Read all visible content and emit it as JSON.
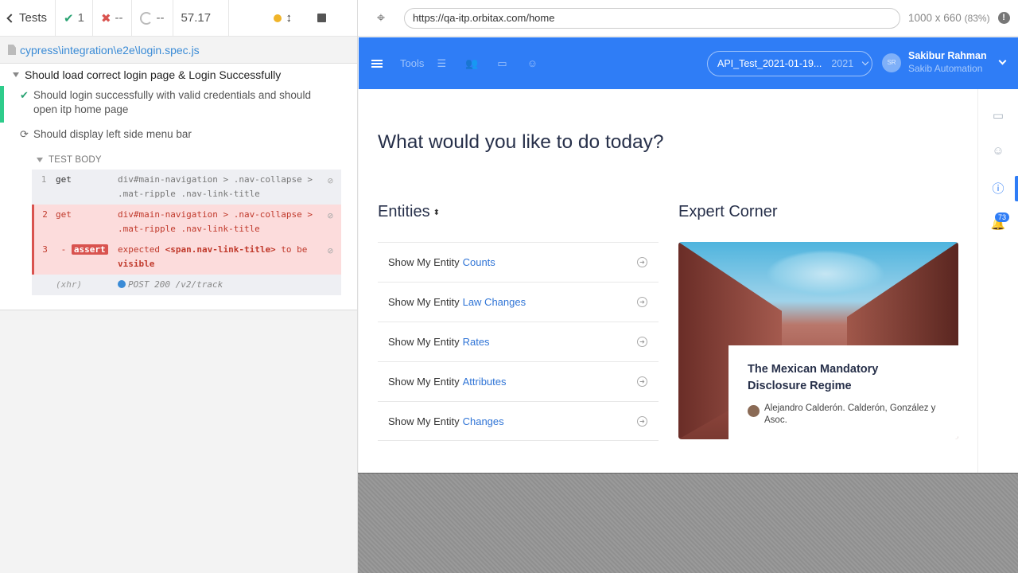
{
  "reporter": {
    "back_label": "Tests",
    "passed_count": "1",
    "failed_count": "--",
    "pending_count": "--",
    "duration": "57.17",
    "spec_path": "cypress\\integration\\e2e\\login.spec.js",
    "suite_title": "Should load correct login page & Login Successfully",
    "tests": [
      {
        "title": "Should login successfully with valid credentials and should open itp home page",
        "state": "passed"
      },
      {
        "title": "Should display left side menu bar",
        "state": "running"
      }
    ],
    "test_body_label": "TEST BODY",
    "commands": [
      {
        "num": "1",
        "name": "get",
        "message": "div#main-navigation > .nav-collapse > .mat-ripple .nav-link-title"
      },
      {
        "num": "2",
        "name": "get",
        "message": "div#main-navigation > .nav-collapse > .mat-ripple .nav-link-title"
      },
      {
        "num": "3",
        "name": "-assert",
        "badge": "assert",
        "message_pre": "expected",
        "message_el": "<span.nav-link-title>",
        "message_mid": "to be",
        "message_post": "visible"
      },
      {
        "num": "",
        "name": "(xhr)",
        "message": "POST 200 /v2/track"
      }
    ]
  },
  "browser": {
    "url": "https://qa-itp.orbitax.com/home",
    "viewport": "1000 x 660",
    "scale": "(83%)"
  },
  "app": {
    "tools_label": "Tools",
    "entity_selector": "API_Test_2021-01-19...",
    "entity_year": "2021",
    "avatar_initials": "SR",
    "user_name": "Sakibur Rahman",
    "user_org": "Sakib Automation",
    "notification_count": "73",
    "heading": "What would you like to do today?",
    "entities_title": "Entities",
    "expert_title": "Expert Corner",
    "entity_prefix": "Show My Entity",
    "entity_items": [
      "Counts",
      "Law Changes",
      "Rates",
      "Attributes",
      "Changes"
    ],
    "article_title": "The Mexican Mandatory Disclosure Regime",
    "article_author": "Alejandro Calderón. Calderón, González y Asoc.",
    "colors": {
      "brand_blue": "#2f7df6",
      "pass_green": "#2aa373",
      "fail_red": "#d9534f"
    }
  }
}
